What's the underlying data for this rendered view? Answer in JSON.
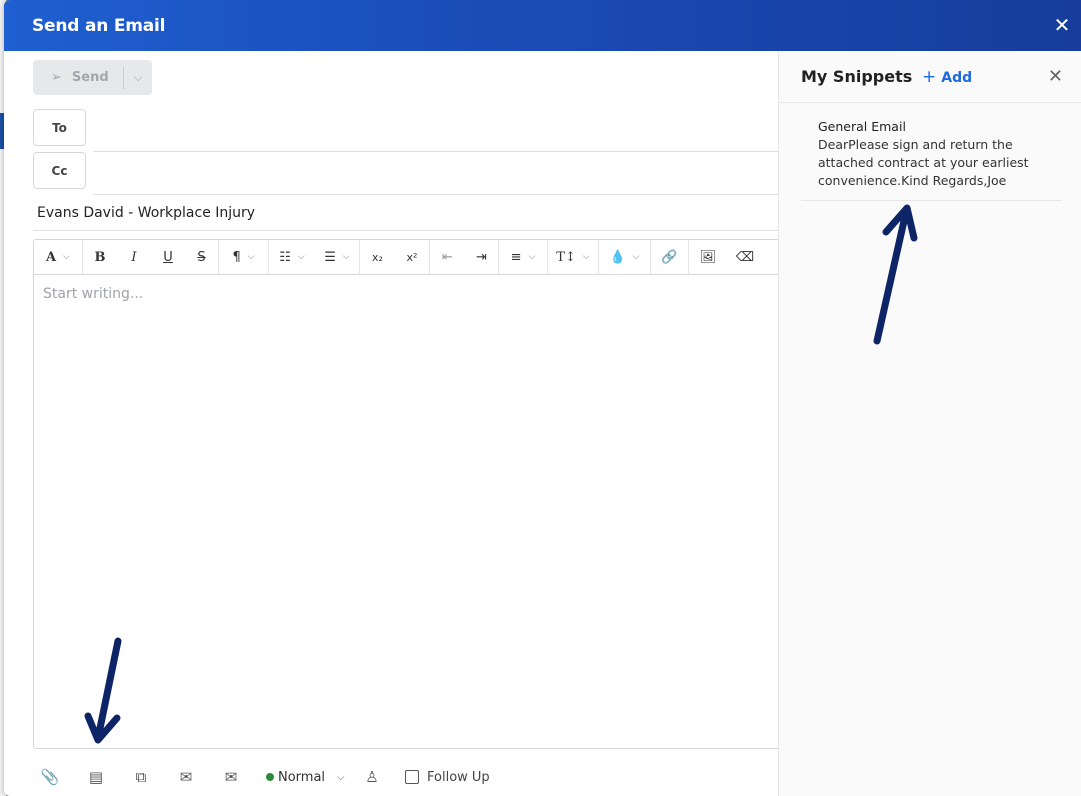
{
  "modal": {
    "title": "Send an Email",
    "close_icon": "close-icon"
  },
  "composer": {
    "send_label": "Send",
    "to_label": "To",
    "cc_label": "Cc",
    "subject_value": "Evans David - Workplace Injury",
    "editor_placeholder": "Start writing...",
    "toolbar_icons": [
      "font-family-icon",
      "bold-icon",
      "italic-icon",
      "underline-icon",
      "strikethrough-icon",
      "paragraph-icon",
      "ordered-list-icon",
      "unordered-list-icon",
      "subscript-icon",
      "superscript-icon",
      "outdent-icon",
      "indent-icon",
      "align-icon",
      "text-size-icon",
      "text-color-icon",
      "link-icon",
      "image-icon",
      "eraser-icon"
    ]
  },
  "footer": {
    "priority_value": "Normal",
    "follow_up_label": "Follow Up",
    "priority_color": "#2e8b3a"
  },
  "snippets": {
    "title": "My Snippets",
    "add_label": "Add",
    "items": [
      {
        "name": "General Email",
        "body": "DearPlease sign and return the attached contract at your earliest convenience.Kind Regards,Joe"
      }
    ]
  },
  "colors": {
    "header_blue": "#1a4cb7",
    "accent": "#1e6ae0",
    "annotation_arrow": "#0d2466"
  }
}
